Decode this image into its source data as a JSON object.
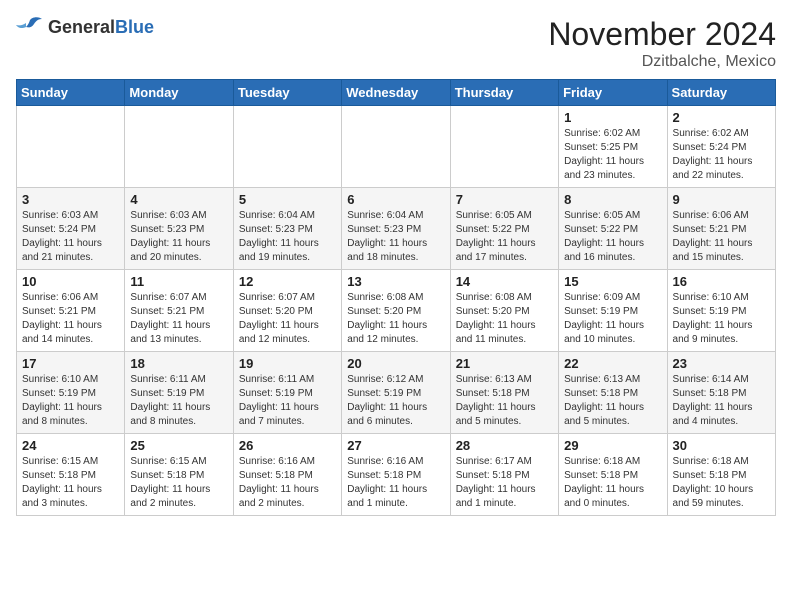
{
  "logo": {
    "general": "General",
    "blue": "Blue"
  },
  "title": "November 2024",
  "location": "Dzitbalche, Mexico",
  "weekdays": [
    "Sunday",
    "Monday",
    "Tuesday",
    "Wednesday",
    "Thursday",
    "Friday",
    "Saturday"
  ],
  "weeks": [
    [
      {
        "day": "",
        "info": ""
      },
      {
        "day": "",
        "info": ""
      },
      {
        "day": "",
        "info": ""
      },
      {
        "day": "",
        "info": ""
      },
      {
        "day": "",
        "info": ""
      },
      {
        "day": "1",
        "info": "Sunrise: 6:02 AM\nSunset: 5:25 PM\nDaylight: 11 hours and 23 minutes."
      },
      {
        "day": "2",
        "info": "Sunrise: 6:02 AM\nSunset: 5:24 PM\nDaylight: 11 hours and 22 minutes."
      }
    ],
    [
      {
        "day": "3",
        "info": "Sunrise: 6:03 AM\nSunset: 5:24 PM\nDaylight: 11 hours and 21 minutes."
      },
      {
        "day": "4",
        "info": "Sunrise: 6:03 AM\nSunset: 5:23 PM\nDaylight: 11 hours and 20 minutes."
      },
      {
        "day": "5",
        "info": "Sunrise: 6:04 AM\nSunset: 5:23 PM\nDaylight: 11 hours and 19 minutes."
      },
      {
        "day": "6",
        "info": "Sunrise: 6:04 AM\nSunset: 5:23 PM\nDaylight: 11 hours and 18 minutes."
      },
      {
        "day": "7",
        "info": "Sunrise: 6:05 AM\nSunset: 5:22 PM\nDaylight: 11 hours and 17 minutes."
      },
      {
        "day": "8",
        "info": "Sunrise: 6:05 AM\nSunset: 5:22 PM\nDaylight: 11 hours and 16 minutes."
      },
      {
        "day": "9",
        "info": "Sunrise: 6:06 AM\nSunset: 5:21 PM\nDaylight: 11 hours and 15 minutes."
      }
    ],
    [
      {
        "day": "10",
        "info": "Sunrise: 6:06 AM\nSunset: 5:21 PM\nDaylight: 11 hours and 14 minutes."
      },
      {
        "day": "11",
        "info": "Sunrise: 6:07 AM\nSunset: 5:21 PM\nDaylight: 11 hours and 13 minutes."
      },
      {
        "day": "12",
        "info": "Sunrise: 6:07 AM\nSunset: 5:20 PM\nDaylight: 11 hours and 12 minutes."
      },
      {
        "day": "13",
        "info": "Sunrise: 6:08 AM\nSunset: 5:20 PM\nDaylight: 11 hours and 12 minutes."
      },
      {
        "day": "14",
        "info": "Sunrise: 6:08 AM\nSunset: 5:20 PM\nDaylight: 11 hours and 11 minutes."
      },
      {
        "day": "15",
        "info": "Sunrise: 6:09 AM\nSunset: 5:19 PM\nDaylight: 11 hours and 10 minutes."
      },
      {
        "day": "16",
        "info": "Sunrise: 6:10 AM\nSunset: 5:19 PM\nDaylight: 11 hours and 9 minutes."
      }
    ],
    [
      {
        "day": "17",
        "info": "Sunrise: 6:10 AM\nSunset: 5:19 PM\nDaylight: 11 hours and 8 minutes."
      },
      {
        "day": "18",
        "info": "Sunrise: 6:11 AM\nSunset: 5:19 PM\nDaylight: 11 hours and 8 minutes."
      },
      {
        "day": "19",
        "info": "Sunrise: 6:11 AM\nSunset: 5:19 PM\nDaylight: 11 hours and 7 minutes."
      },
      {
        "day": "20",
        "info": "Sunrise: 6:12 AM\nSunset: 5:19 PM\nDaylight: 11 hours and 6 minutes."
      },
      {
        "day": "21",
        "info": "Sunrise: 6:13 AM\nSunset: 5:18 PM\nDaylight: 11 hours and 5 minutes."
      },
      {
        "day": "22",
        "info": "Sunrise: 6:13 AM\nSunset: 5:18 PM\nDaylight: 11 hours and 5 minutes."
      },
      {
        "day": "23",
        "info": "Sunrise: 6:14 AM\nSunset: 5:18 PM\nDaylight: 11 hours and 4 minutes."
      }
    ],
    [
      {
        "day": "24",
        "info": "Sunrise: 6:15 AM\nSunset: 5:18 PM\nDaylight: 11 hours and 3 minutes."
      },
      {
        "day": "25",
        "info": "Sunrise: 6:15 AM\nSunset: 5:18 PM\nDaylight: 11 hours and 2 minutes."
      },
      {
        "day": "26",
        "info": "Sunrise: 6:16 AM\nSunset: 5:18 PM\nDaylight: 11 hours and 2 minutes."
      },
      {
        "day": "27",
        "info": "Sunrise: 6:16 AM\nSunset: 5:18 PM\nDaylight: 11 hours and 1 minute."
      },
      {
        "day": "28",
        "info": "Sunrise: 6:17 AM\nSunset: 5:18 PM\nDaylight: 11 hours and 1 minute."
      },
      {
        "day": "29",
        "info": "Sunrise: 6:18 AM\nSunset: 5:18 PM\nDaylight: 11 hours and 0 minutes."
      },
      {
        "day": "30",
        "info": "Sunrise: 6:18 AM\nSunset: 5:18 PM\nDaylight: 10 hours and 59 minutes."
      }
    ]
  ]
}
